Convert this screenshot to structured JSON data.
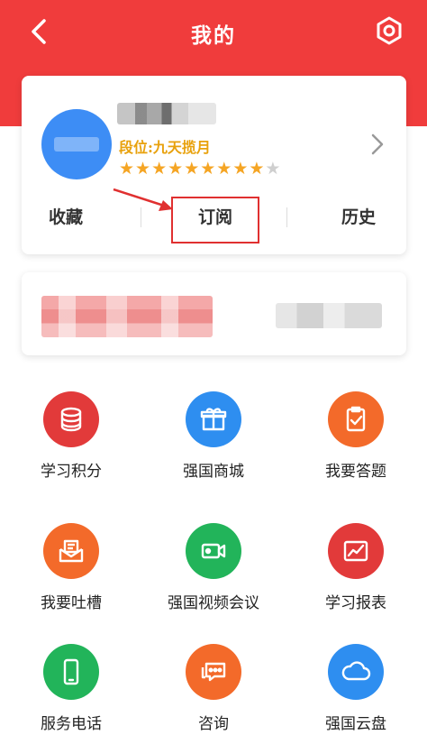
{
  "header": {
    "title": "我的",
    "back_icon": "chevron-left-icon",
    "settings_icon": "gear-icon",
    "color": "#f03c3c"
  },
  "profile": {
    "rank": "段位:九天揽月",
    "stars": {
      "filled": 9,
      "total": 10,
      "filled_color": "#f5a524"
    },
    "tabs": [
      {
        "label": "收藏"
      },
      {
        "label": "订阅"
      },
      {
        "label": "历史"
      }
    ]
  },
  "grid": [
    {
      "label": "学习积分",
      "icon": "coins-icon",
      "color": "#e23a3a"
    },
    {
      "label": "强国商城",
      "icon": "gift-box-icon",
      "color": "#2e8ef0"
    },
    {
      "label": "我要答题",
      "icon": "clipboard-check-icon",
      "color": "#f36a2a"
    },
    {
      "label": "我要吐槽",
      "icon": "mail-envelope-icon",
      "color": "#f36a2a"
    },
    {
      "label": "强国视频会议",
      "icon": "video-camera-icon",
      "color": "#22b45a"
    },
    {
      "label": "学习报表",
      "icon": "chart-report-icon",
      "color": "#e23a3a"
    },
    {
      "label": "服务电话",
      "icon": "phone-icon",
      "color": "#22b45a"
    },
    {
      "label": "咨询",
      "icon": "chat-bubble-icon",
      "color": "#f36a2a"
    },
    {
      "label": "强国云盘",
      "icon": "cloud-icon",
      "color": "#2e8ef0"
    }
  ]
}
